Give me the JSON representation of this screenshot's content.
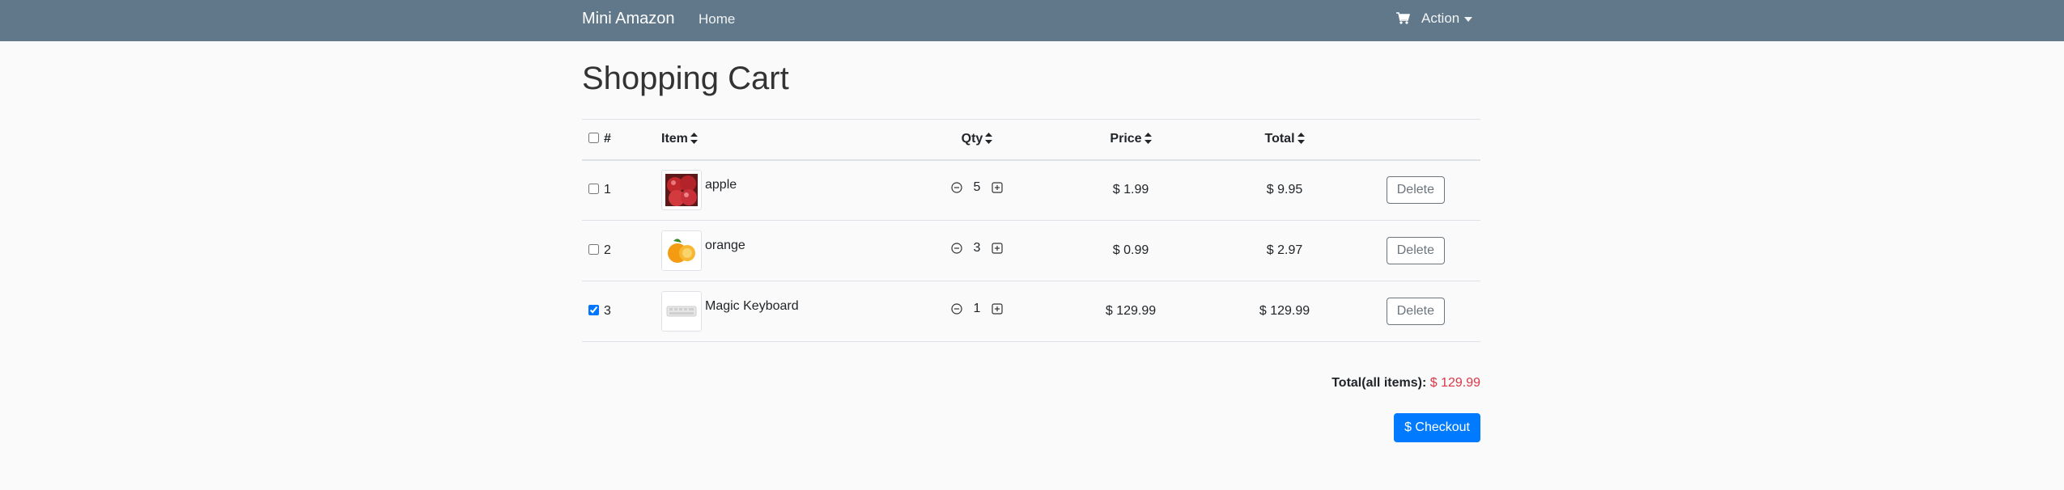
{
  "navbar": {
    "brand": "Mini Amazon",
    "home_label": "Home",
    "action_label": "Action",
    "cart_icon": "shopping-cart-icon"
  },
  "page": {
    "title": "Shopping Cart"
  },
  "table": {
    "headers": {
      "num": "#",
      "item": "Item",
      "qty": "Qty",
      "price": "Price",
      "total": "Total"
    },
    "rows": [
      {
        "num": "1",
        "checked": false,
        "name": "apple",
        "image": "apple",
        "qty": "5",
        "price": "$ 1.99",
        "total": "$ 9.95",
        "delete_label": "Delete"
      },
      {
        "num": "2",
        "checked": false,
        "name": "orange",
        "image": "orange",
        "qty": "3",
        "price": "$ 0.99",
        "total": "$ 2.97",
        "delete_label": "Delete"
      },
      {
        "num": "3",
        "checked": true,
        "name": "Magic Keyboard",
        "image": "keyboard",
        "qty": "1",
        "price": "$ 129.99",
        "total": "$ 129.99",
        "delete_label": "Delete"
      }
    ]
  },
  "summary": {
    "label": "Total(all items):",
    "amount": "$ 129.99"
  },
  "checkout": {
    "label": "$ Checkout"
  },
  "colors": {
    "navbar": "#607889",
    "primary": "#007bff",
    "danger": "#dc3545"
  }
}
